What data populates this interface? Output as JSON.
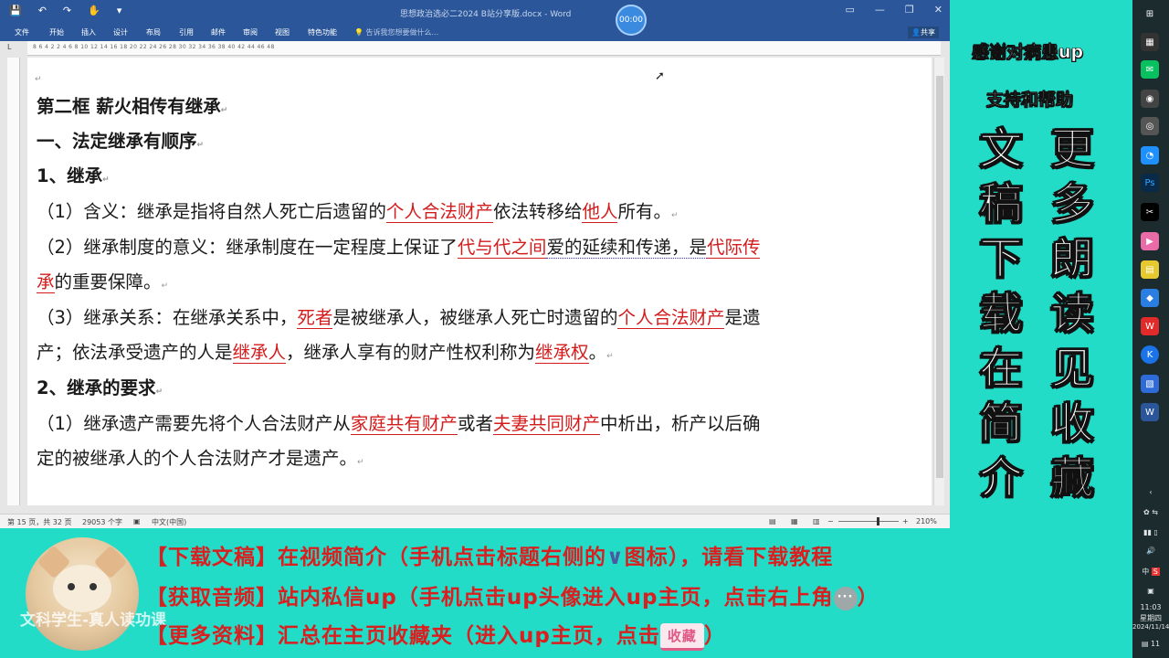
{
  "window": {
    "title": "思想政治选必二2024 B站分享版.docx - Word",
    "timer": "00:00",
    "controls": [
      "—",
      "❐",
      "✕"
    ]
  },
  "ribbon": {
    "tabs": [
      "文件",
      "开始",
      "插入",
      "设计",
      "布局",
      "引用",
      "邮件",
      "审阅",
      "视图",
      "特色功能"
    ],
    "tell_me": "告诉我您想要做什么...",
    "share": "共享"
  },
  "ruler": {
    "numbers": "8 6 4 2 2 4 6 8 10 12 14 16 18 20 22 24 26 28 30 32 34 36 38 40 42 44 46 48"
  },
  "document": {
    "title": "第二框  薪火相传有继承",
    "section1": "一、法定继承有顺序",
    "sub1": "1、继承",
    "l1": {
      "a": "（1）含义：继承是指将自然人死亡后遗留的",
      "k1": "个人合法财产",
      "b": "依法转移给",
      "k2": "他人",
      "c": "所有。"
    },
    "l2": {
      "a": "（2）继承制度的意义：继承制度在一定程度上保证了",
      "k1": "代与代之间",
      "b": "爱的延续和传递，是",
      "k2": "代际传"
    },
    "l3": {
      "k1": "承",
      "a": "的重要保障。"
    },
    "l4": {
      "a": "（3）继承关系：在继承关系中，",
      "k1": "死者",
      "b": "是被继承人，被继承人死亡时遗留的",
      "k2": "个人合法财产",
      "c": "是遗"
    },
    "l5": {
      "a": "产；依法承受遗产的人是",
      "k1": "继承人",
      "b": "，继承人享有的财产性权利称为",
      "k2": "继承权",
      "c": "。"
    },
    "sub2": "2、继承的要求",
    "l6": {
      "a": "（1）继承遗产需要先将个人合法财产从",
      "k1": "家庭共有财产",
      "b": "或者",
      "k2": "夫妻共同财产",
      "c": "中析出，析产以后确"
    },
    "l7": {
      "a": "定的被继承人的个人合法财产才是遗产。"
    },
    "para_mark": "↵"
  },
  "status": {
    "page": "第 15 页，共 32 页",
    "words": "29053 个字",
    "lang": "中文(中国)",
    "zoom": "210%"
  },
  "promo": {
    "line1": "感谢对病患up",
    "line2": "支持和帮助",
    "col_left": [
      "文",
      "稿",
      "下",
      "载",
      "在",
      "简",
      "介"
    ],
    "col_right": [
      "更",
      "多",
      "朗",
      "读",
      "见",
      "收",
      "藏"
    ]
  },
  "banner": {
    "b1_tag": "【下载文稿】",
    "b1_a": "在视频简介（手机点击标题右侧的",
    "b1_icon": "∨",
    "b1_b": "图标），请看下载教程",
    "b2_tag": "【获取音频】",
    "b2_a": "站内私信up（手机点击up头像进入up主页，点击右上角",
    "b2_icon": "···",
    "b2_b": "）",
    "b3_tag": "【更多资料】",
    "b3_a": "汇总在主页收藏夹（进入up主页，点击",
    "b3_btn": "收藏",
    "b3_b": "）",
    "watermark": "文科学生-真人读功课"
  },
  "taskbar": {
    "time": "11:03",
    "weekday": "星期四",
    "date": "2024/11/14",
    "ime": "中",
    "notify": "11"
  },
  "colors": {
    "word_blue": "#2b579a",
    "key_red": "#d41b1b",
    "bg_teal": "#22dcc8"
  }
}
